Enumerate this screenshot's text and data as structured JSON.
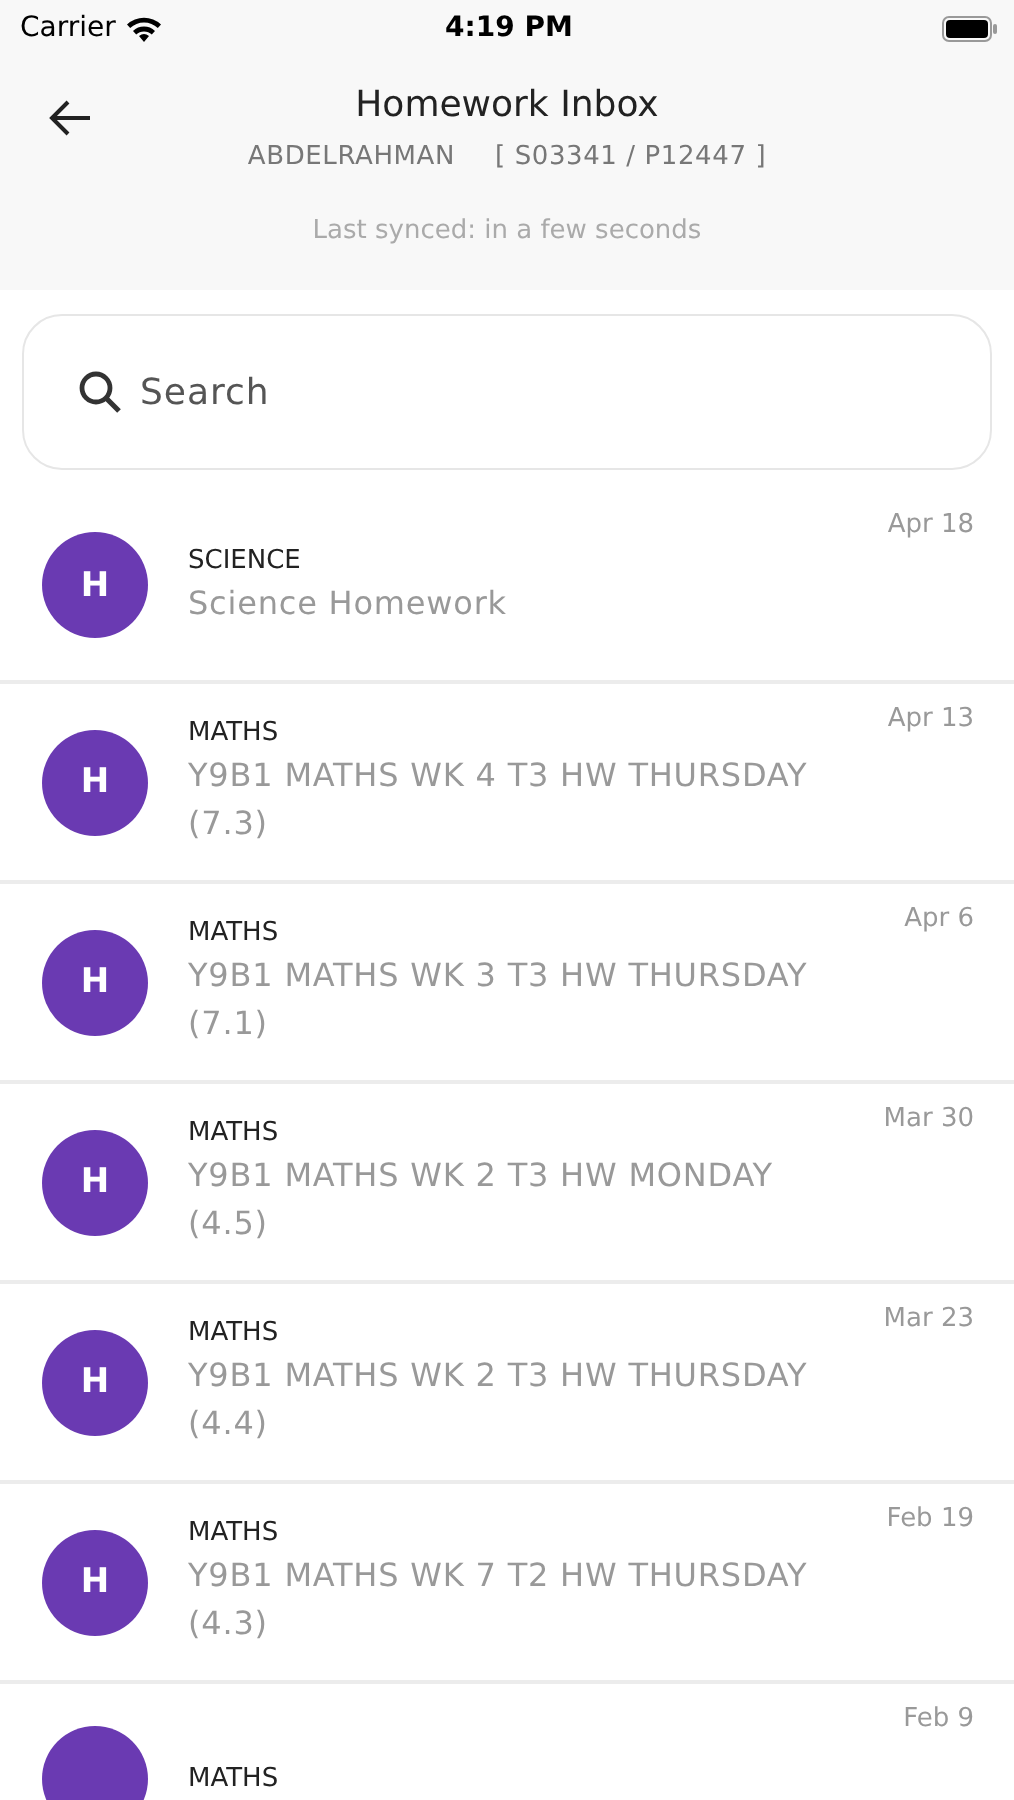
{
  "status_bar": {
    "carrier": "Carrier",
    "time": "4:19 PM"
  },
  "header": {
    "title": "Homework Inbox",
    "student_name": "ABDELRAHMAN",
    "student_ids": "[ S03341 / P12447 ]",
    "last_synced": "Last synced: in a few seconds"
  },
  "search": {
    "placeholder": "Search"
  },
  "messages": [
    {
      "avatar": "H",
      "subject": "SCIENCE",
      "title": "Science Homework",
      "date": "Apr 18"
    },
    {
      "avatar": "H",
      "subject": "MATHS",
      "title": "Y9B1 MATHS WK 4 T3 HW THURSDAY (7.3)",
      "date": "Apr 13"
    },
    {
      "avatar": "H",
      "subject": "MATHS",
      "title": "Y9B1 MATHS WK 3 T3 HW THURSDAY (7.1)",
      "date": "Apr 6"
    },
    {
      "avatar": "H",
      "subject": "MATHS",
      "title": "Y9B1 MATHS WK 2 T3 HW MONDAY (4.5)",
      "date": "Mar 30"
    },
    {
      "avatar": "H",
      "subject": "MATHS",
      "title": "Y9B1 MATHS WK 2 T3 HW THURSDAY (4.4)",
      "date": "Mar 23"
    },
    {
      "avatar": "H",
      "subject": "MATHS",
      "title": "Y9B1 MATHS WK 7 T2 HW THURSDAY (4.3)",
      "date": "Feb 19"
    },
    {
      "subject": "MATHS",
      "date": "Feb 9"
    }
  ]
}
